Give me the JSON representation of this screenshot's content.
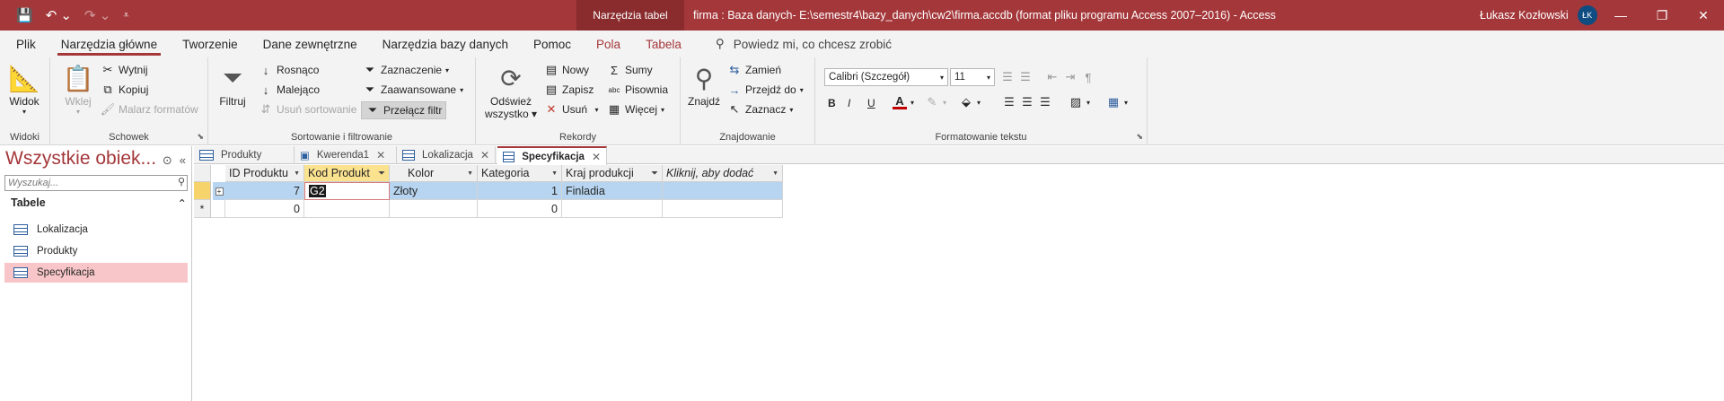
{
  "titlebar": {
    "context_tab": "Narzędzia tabel",
    "title": "firma : Baza danych- E:\\semestr4\\bazy_danych\\cw2\\firma.accdb (format pliku programu Access 2007–2016)  -  Access",
    "user_name": "Łukasz Kozłowski",
    "user_initials": "ŁK"
  },
  "menu": {
    "tabs": [
      "Plik",
      "Narzędzia główne",
      "Tworzenie",
      "Dane zewnętrzne",
      "Narzędzia bazy danych",
      "Pomoc",
      "Pola",
      "Tabela"
    ],
    "tell_me": "Powiedz mi, co chcesz zrobić"
  },
  "ribbon": {
    "widoki": {
      "view": "Widok",
      "label": "Widoki"
    },
    "schowek": {
      "paste": "Wklej",
      "cut": "Wytnij",
      "copy": "Kopiuj",
      "format_painter": "Malarz formatów",
      "label": "Schowek"
    },
    "sort": {
      "filter": "Filtruj",
      "asc": "Rosnąco",
      "desc": "Malejąco",
      "remove_sort": "Usuń sortowanie",
      "selection": "Zaznaczenie",
      "advanced": "Zaawansowane",
      "toggle_filter": "Przełącz filtr",
      "label": "Sortowanie i filtrowanie"
    },
    "rekordy": {
      "refresh_1": "Odśwież",
      "refresh_2": "wszystko",
      "new": "Nowy",
      "save": "Zapisz",
      "delete": "Usuń",
      "totals": "Sumy",
      "spelling": "Pisownia",
      "more": "Więcej",
      "label": "Rekordy"
    },
    "znajdowanie": {
      "find": "Znajdź",
      "replace": "Zamień",
      "goto": "Przejdź do",
      "select": "Zaznacz",
      "label": "Znajdowanie"
    },
    "formatowanie": {
      "font": "Calibri (Szczegół)",
      "size": "11",
      "bold": "B",
      "italic": "I",
      "underline": "U",
      "label": "Formatowanie tekstu"
    }
  },
  "nav": {
    "title": "Wszystkie obiek...",
    "search_placeholder": "Wyszukaj...",
    "group": "Tabele",
    "items": [
      "Lokalizacja",
      "Produkty",
      "Specyfikacja"
    ]
  },
  "doc_tabs": [
    "Produkty",
    "Kwerenda1",
    "Lokalizacja",
    "Specyfikacja"
  ],
  "table": {
    "columns": [
      "ID Produktu",
      "Kod Produkt",
      "Kolor",
      "Kategoria",
      "Kraj produkcji",
      "Kliknij, aby dodać"
    ],
    "rows": [
      [
        "7",
        "G2",
        "Złoty",
        "1",
        "Finladia",
        ""
      ],
      [
        "0",
        "",
        "",
        "0",
        "",
        ""
      ]
    ],
    "new_row_marker": "*"
  },
  "colors": {
    "accent": "#a4373a",
    "selected_row": "#b7d5f0",
    "selected_nav": "#f8c6c8"
  }
}
